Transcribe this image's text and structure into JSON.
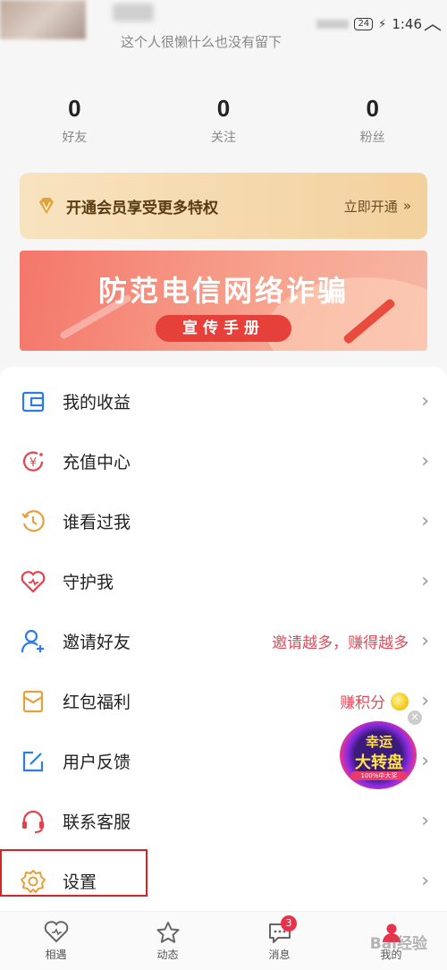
{
  "status_bar": {
    "time": "1:46",
    "battery": "24"
  },
  "profile": {
    "bio": "这个人很懒什么也没有留下"
  },
  "stats": [
    {
      "num": "0",
      "label": "好友"
    },
    {
      "num": "0",
      "label": "关注"
    },
    {
      "num": "0",
      "label": "粉丝"
    }
  ],
  "vip": {
    "text": "开通会员享受更多特权",
    "action": "立即开通",
    "arrow": "»"
  },
  "banner": {
    "title": "防范电信网络诈骗",
    "subtitle": "宣传手册"
  },
  "menu": [
    {
      "label": "我的收益",
      "extra": "",
      "icon": "wallet-icon"
    },
    {
      "label": "充值中心",
      "extra": "",
      "icon": "yuan-icon"
    },
    {
      "label": "谁看过我",
      "extra": "",
      "icon": "clock-icon"
    },
    {
      "label": "守护我",
      "extra": "",
      "icon": "heart-icon"
    },
    {
      "label": "邀请好友",
      "extra": "邀请越多，赚得越多",
      "icon": "add-user-icon"
    },
    {
      "label": "红包福利",
      "extra": "赚积分",
      "icon": "red-packet-icon"
    },
    {
      "label": "用户反馈",
      "extra": "",
      "icon": "edit-icon"
    },
    {
      "label": "联系客服",
      "extra": "",
      "icon": "headset-icon"
    },
    {
      "label": "设置",
      "extra": "",
      "icon": "gear-icon"
    }
  ],
  "lucky_wheel": {
    "line1": "幸运",
    "line2": "大转盘",
    "line3": "100%中大奖"
  },
  "tabs": [
    {
      "label": "相遇",
      "icon": "heart-outline-icon"
    },
    {
      "label": "动态",
      "icon": "star-icon"
    },
    {
      "label": "消息",
      "icon": "chat-icon",
      "badge": "3"
    },
    {
      "label": "我的",
      "icon": "profile-icon"
    }
  ],
  "watermark": "Bai经验",
  "colors": {
    "accent": "#e14b58",
    "icon_blue": "#2f7be5",
    "icon_red": "#e5414b",
    "icon_orange": "#e8a03a",
    "highlight": "#d62424"
  }
}
